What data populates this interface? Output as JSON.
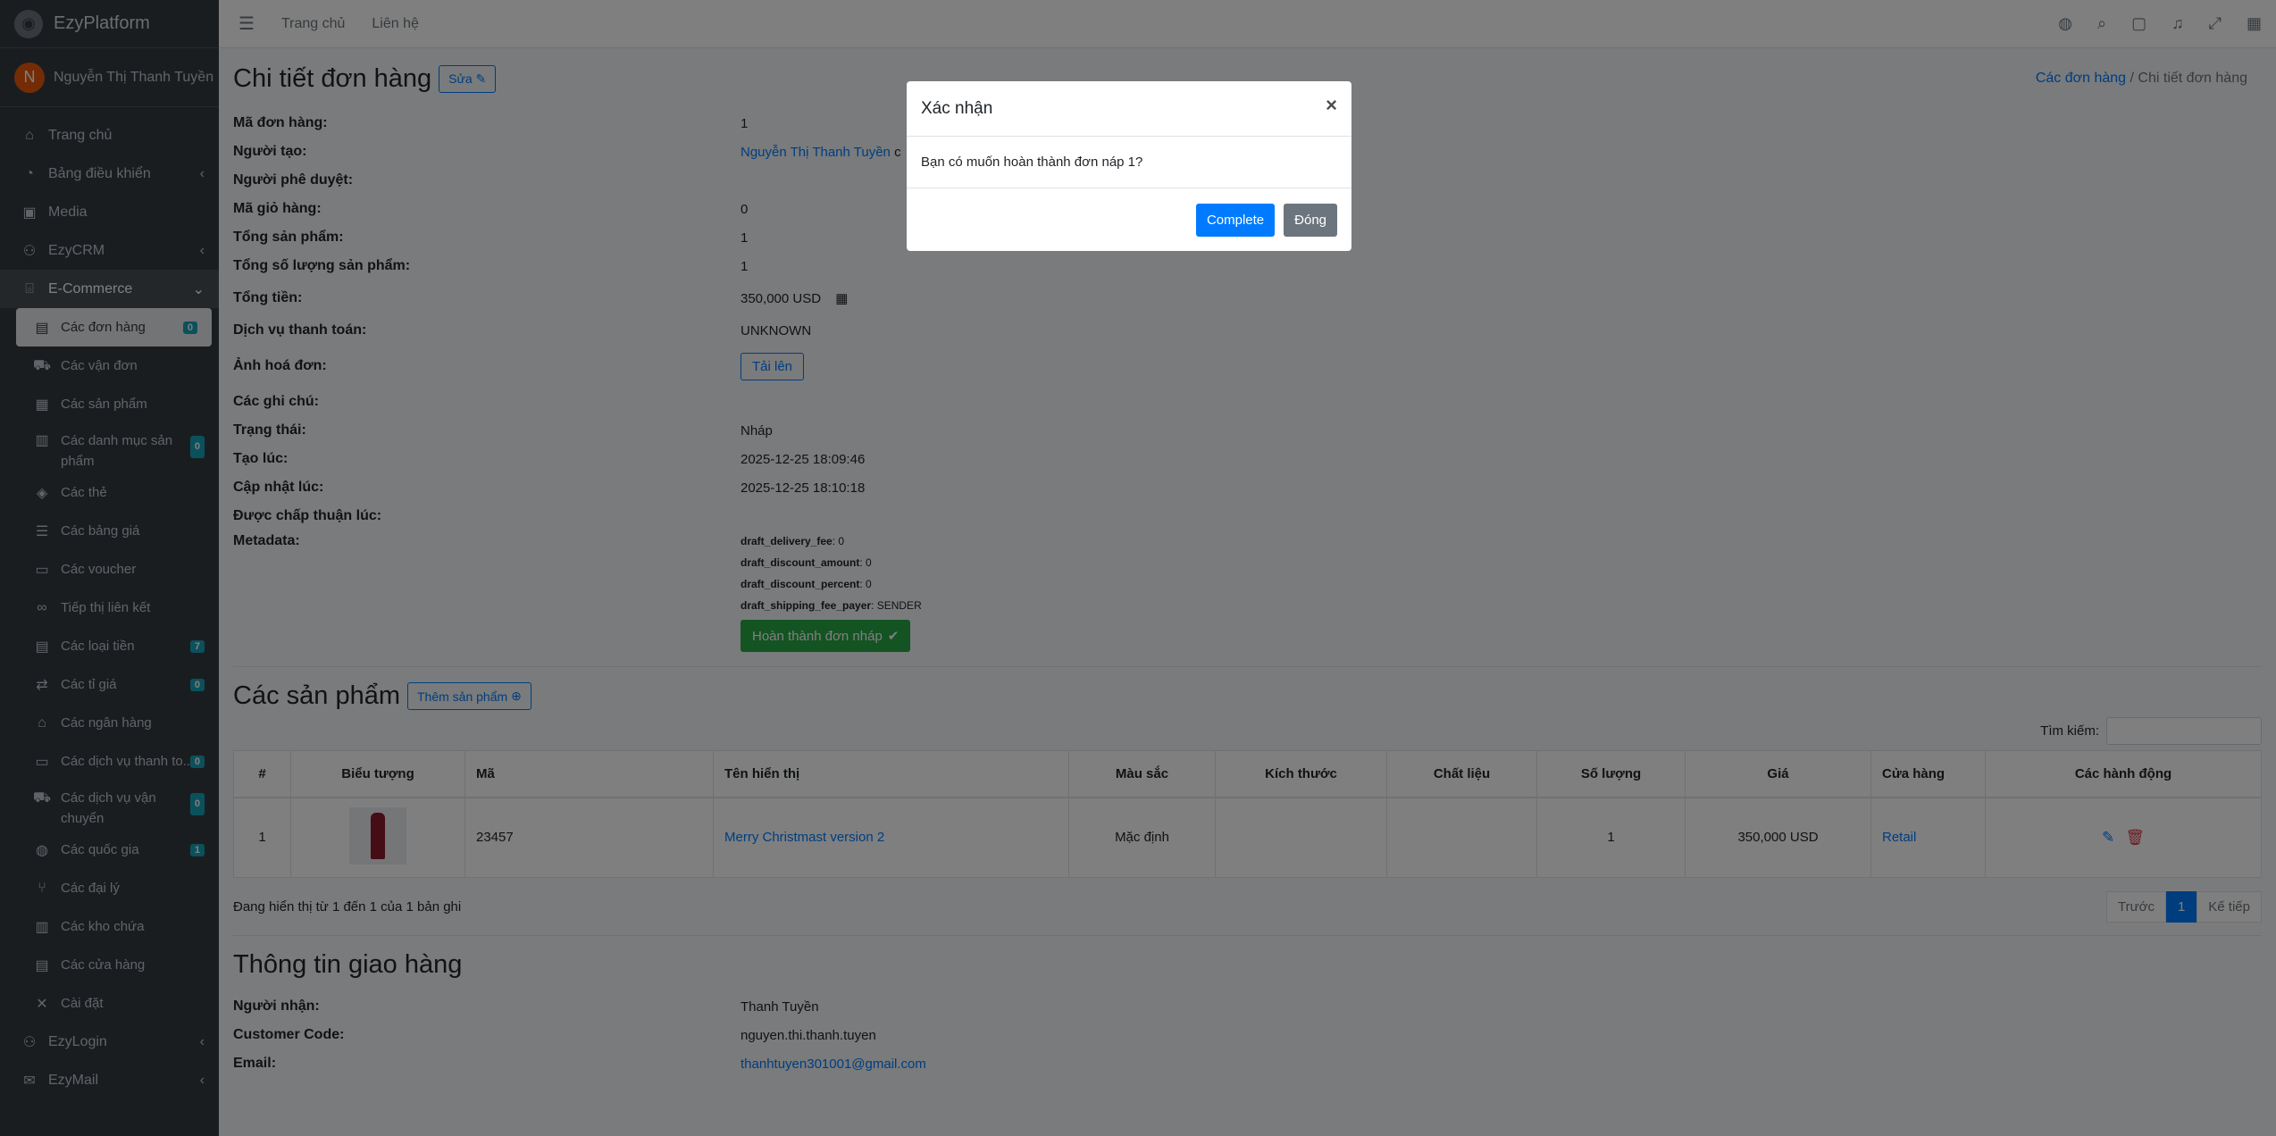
{
  "app": {
    "name": "EzyPlatform"
  },
  "user": {
    "initial": "N",
    "name": "Nguyễn Thị Thanh Tuyền"
  },
  "sidebar": {
    "items": [
      {
        "icon": "home-icon",
        "glyph": "⌂",
        "label": "Trang chủ"
      },
      {
        "icon": "dashboard-icon",
        "glyph": "◔",
        "label": "Bảng điều khiển",
        "chevron": "‹"
      },
      {
        "icon": "media-icon",
        "glyph": "▣",
        "label": "Media"
      },
      {
        "icon": "handshake-icon",
        "glyph": "⚇",
        "label": "EzyCRM",
        "chevron": "‹"
      },
      {
        "icon": "basket-icon",
        "glyph": "⌺",
        "label": "E-Commerce",
        "chevron": "⌄"
      }
    ],
    "sub": [
      {
        "icon": "file-icon",
        "glyph": "▤",
        "label": "Các đơn hàng",
        "badge": "0"
      },
      {
        "icon": "truck-icon",
        "glyph": "⛟",
        "label": "Các vận đơn"
      },
      {
        "icon": "boxes-icon",
        "glyph": "▦",
        "label": "Các sản phẩm"
      },
      {
        "icon": "clipboard-icon",
        "glyph": "▥",
        "label": "Các danh mục sản phẩm",
        "badge": "0"
      },
      {
        "icon": "tags-icon",
        "glyph": "◈",
        "label": "Các thẻ"
      },
      {
        "icon": "list-icon",
        "glyph": "☰",
        "label": "Các bảng giá"
      },
      {
        "icon": "ticket-icon",
        "glyph": "▭",
        "label": "Các voucher"
      },
      {
        "icon": "link-icon",
        "glyph": "∞",
        "label": "Tiếp thị liên kết"
      },
      {
        "icon": "money-icon",
        "glyph": "▤",
        "label": "Các loại tiền",
        "badge": "7"
      },
      {
        "icon": "exchange-icon",
        "glyph": "⇄",
        "label": "Các tỉ giá",
        "badge": "0"
      },
      {
        "icon": "bank-icon",
        "glyph": "⌂",
        "label": "Các ngân hàng"
      },
      {
        "icon": "credit-card-icon",
        "glyph": "▭",
        "label": "Các dịch vụ thanh to...",
        "badge": "0"
      },
      {
        "icon": "shipping-icon",
        "glyph": "⛟",
        "label": "Các dịch vụ vận chuyển",
        "badge": "0"
      },
      {
        "icon": "globe-icon",
        "glyph": "◍",
        "label": "Các quốc gia",
        "badge": "1"
      },
      {
        "icon": "branch-icon",
        "glyph": "⑂",
        "label": "Các đại lý"
      },
      {
        "icon": "warehouse-icon",
        "glyph": "▥",
        "label": "Các kho chứa"
      },
      {
        "icon": "store-icon",
        "glyph": "▤",
        "label": "Các cửa hàng"
      },
      {
        "icon": "tools-icon",
        "glyph": "✕",
        "label": "Cài đặt"
      }
    ],
    "bottom": [
      {
        "icon": "user-lock-icon",
        "glyph": "⚇",
        "label": "EzyLogin",
        "chevron": "‹"
      },
      {
        "icon": "envelope-icon",
        "glyph": "✉",
        "label": "EzyMail",
        "chevron": "‹"
      }
    ]
  },
  "topbar": {
    "links": [
      "Trang chủ",
      "Liên hệ"
    ]
  },
  "page": {
    "title": "Chi tiết đơn hàng",
    "edit_label": "Sửa",
    "breadcrumb": {
      "parent": "Các đơn hàng",
      "current": "Chi tiết đơn hàng"
    }
  },
  "order": {
    "fields": [
      {
        "label": "Mã đơn hàng:",
        "value": "1"
      },
      {
        "label": "Người tạo:",
        "value": "Nguyễn Thị Thanh Tuyền",
        "link": true,
        "suffix": "c"
      },
      {
        "label": "Người phê duyệt:",
        "value": ""
      },
      {
        "label": "Mã giỏ hàng:",
        "value": "0"
      },
      {
        "label": "Tổng sản phẩm:",
        "value": "1"
      },
      {
        "label": "Tổng số lượng sản phẩm:",
        "value": "1"
      },
      {
        "label": "Tổng tiền:",
        "value": "350,000 USD"
      },
      {
        "label": "Dịch vụ thanh toán:",
        "value": "UNKNOWN"
      },
      {
        "label": "Ảnh hoá đơn:",
        "button": "Tải lên"
      },
      {
        "label": "Các ghi chú:",
        "value": ""
      },
      {
        "label": "Trạng thái:",
        "value": "Nháp"
      },
      {
        "label": "Tạo lúc:",
        "value": "2025-12-25 18:09:46"
      },
      {
        "label": "Cập nhật lúc:",
        "value": "2025-12-25 18:10:18"
      },
      {
        "label": "Được chấp thuận lúc:",
        "value": ""
      }
    ],
    "metadata_label": "Metadata:",
    "metadata": [
      {
        "key": "draft_delivery_fee",
        "value": "0"
      },
      {
        "key": "draft_discount_amount",
        "value": "0"
      },
      {
        "key": "draft_discount_percent",
        "value": "0"
      },
      {
        "key": "draft_shipping_fee_payer",
        "value": "SENDER"
      }
    ],
    "complete_draft_label": "Hoàn thành đơn nháp"
  },
  "products": {
    "title": "Các sản phẩm",
    "add_label": "Thêm sản phẩm",
    "search_label": "Tìm kiếm:",
    "columns": [
      "#",
      "Biểu tượng",
      "Mã",
      "Tên hiển thị",
      "Màu sắc",
      "Kích thước",
      "Chất liệu",
      "Số lượng",
      "Giá",
      "Cửa hàng",
      "Các hành động"
    ],
    "rows": [
      {
        "index": "1",
        "code": "23457",
        "name": "Merry Christmast version 2",
        "color": "Mặc định",
        "size": "",
        "material": "",
        "qty": "1",
        "price": "350,000 USD",
        "store": "Retail"
      }
    ],
    "summary": "Đang hiển thị từ 1 đến 1 của 1 bản ghi",
    "pager": {
      "prev": "Trước",
      "page": "1",
      "next": "Kế tiếp"
    }
  },
  "shipping": {
    "title": "Thông tin giao hàng",
    "fields": [
      {
        "label": "Người nhận:",
        "value": "Thanh Tuyền"
      },
      {
        "label": "Customer Code:",
        "value": "nguyen.thi.thanh.tuyen"
      },
      {
        "label": "Email:",
        "value": "thanhtuyen301001@gmail.com",
        "link": true
      }
    ]
  },
  "modal": {
    "title": "Xác nhận",
    "close": "×",
    "message": "Bạn có muốn hoàn thành đơn náp 1?",
    "confirm_label": "Complete",
    "cancel_label": "Đóng"
  },
  "colors": {
    "primary": "#007bff",
    "success": "#28a745",
    "sidebar": "#343a40",
    "badge": "#17a2b8"
  }
}
